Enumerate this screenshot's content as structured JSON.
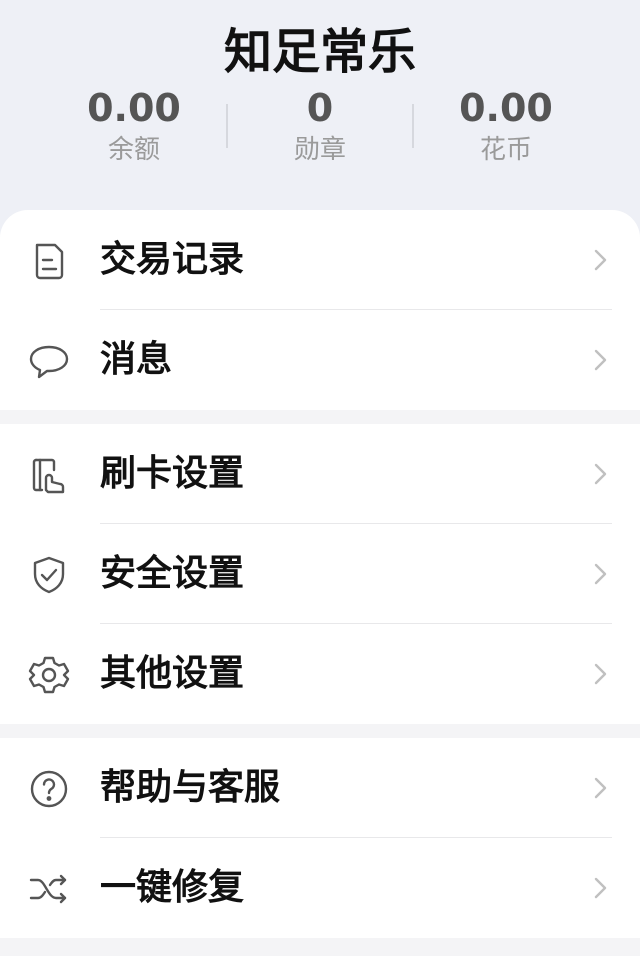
{
  "header": {
    "title": "知足常乐",
    "stats": [
      {
        "value": "0.00",
        "label": "余额"
      },
      {
        "value": "0",
        "label": "勋章"
      },
      {
        "value": "0.00",
        "label": "花币"
      }
    ]
  },
  "menu": {
    "groups": [
      {
        "items": [
          {
            "label": "交易记录",
            "icon": "document-icon"
          },
          {
            "label": "消息",
            "icon": "chat-bubble-icon"
          }
        ]
      },
      {
        "items": [
          {
            "label": "刷卡设置",
            "icon": "card-swipe-icon"
          },
          {
            "label": "安全设置",
            "icon": "shield-check-icon"
          },
          {
            "label": "其他设置",
            "icon": "gear-icon"
          }
        ]
      },
      {
        "items": [
          {
            "label": "帮助与客服",
            "icon": "help-circle-icon"
          },
          {
            "label": "一键修复",
            "icon": "shuffle-icon"
          }
        ]
      }
    ]
  },
  "colors": {
    "header_bg": "#eef0f6",
    "stat_value": "#555555",
    "stat_label": "#9a9a9a",
    "icon": "#555555",
    "chevron": "#c0c0c0",
    "group_gap": "#f4f4f6"
  }
}
